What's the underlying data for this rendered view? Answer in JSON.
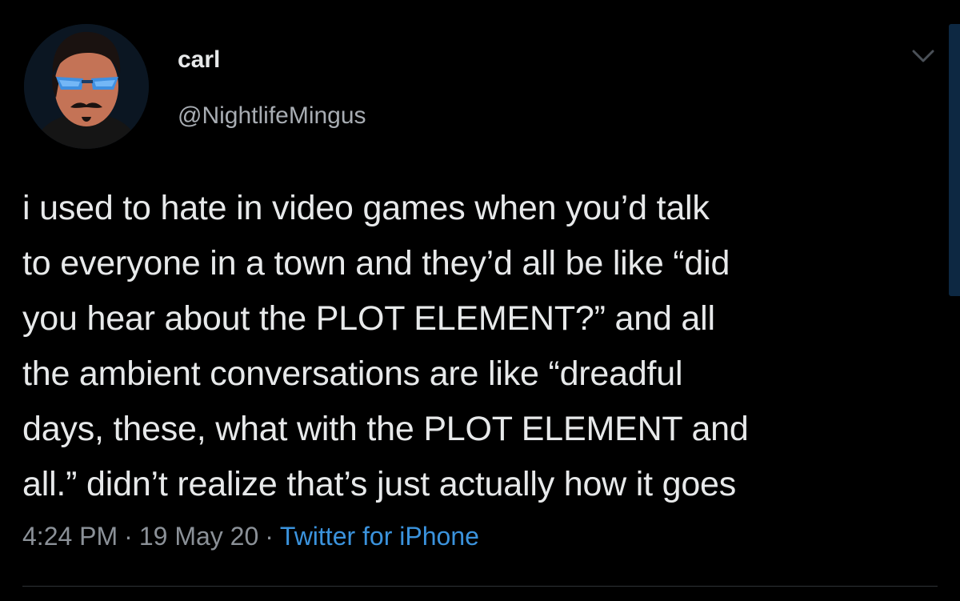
{
  "user": {
    "display_name": "carl",
    "handle": "@NightlifeMingus"
  },
  "tweet": {
    "lines": [
      "i used to hate in video games when you’d talk",
      "to everyone in a town and they’d all be like “did",
      "you hear about the PLOT ELEMENT?” and all",
      "the ambient conversations are like “dreadful",
      "days, these, what with the PLOT ELEMENT and",
      "all.” didn’t realize that’s just actually how it goes"
    ]
  },
  "meta": {
    "time": "4:24 PM",
    "date": "19 May 20",
    "separator": "·",
    "source": "Twitter for iPhone"
  },
  "icons": {
    "avatar": "avatar",
    "more": "chevron-down-icon"
  },
  "colors": {
    "background": "#000000",
    "text": "#e7e9ea",
    "secondary": "#8b9198",
    "link": "#3b93dd"
  }
}
